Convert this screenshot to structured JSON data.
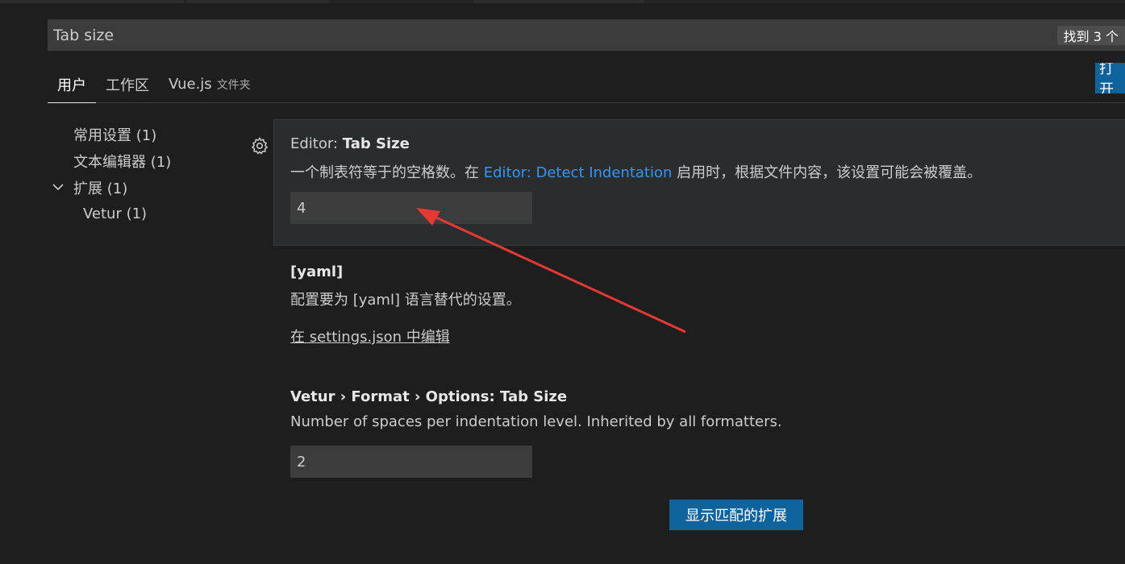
{
  "search": {
    "value": "Tab size",
    "result_count": "找到 3 个"
  },
  "tabs": [
    {
      "label": "用户",
      "active": true
    },
    {
      "label": "工作区",
      "active": false
    },
    {
      "label": "Vue.js",
      "sub": "文件夹",
      "active": false
    }
  ],
  "open_button_label": "打开",
  "toc": [
    {
      "label": "常用设置 (1)"
    },
    {
      "label": "文本编辑器 (1)"
    },
    {
      "label": "扩展 (1)",
      "expanded": true
    },
    {
      "label": "Vetur (1)"
    }
  ],
  "settings": {
    "tab_size": {
      "category": "Editor: ",
      "name": "Tab Size",
      "desc_before": "一个制表符等于的空格数。在 ",
      "desc_link": "Editor: Detect Indentation",
      "desc_after": " 启用时，根据文件内容，该设置可能会被覆盖。",
      "value": "4"
    },
    "yaml": {
      "title": "[yaml]",
      "desc": "配置要为 [yaml] 语言替代的设置。",
      "edit_link": "在 settings.json 中编辑"
    },
    "vetur": {
      "category": "Vetur › Format › Options: ",
      "name": "Tab Size",
      "desc": "Number of spaces per indentation level. Inherited by all formatters.",
      "value": "2"
    }
  },
  "show_matching_extensions_label": "显示匹配的扩展",
  "colors": {
    "accent": "#0e639c",
    "link": "#3794ff",
    "annotation_arrow": "#e53935"
  },
  "icons": {
    "gear": "gear-icon",
    "chevron": "chevron-down-icon"
  }
}
